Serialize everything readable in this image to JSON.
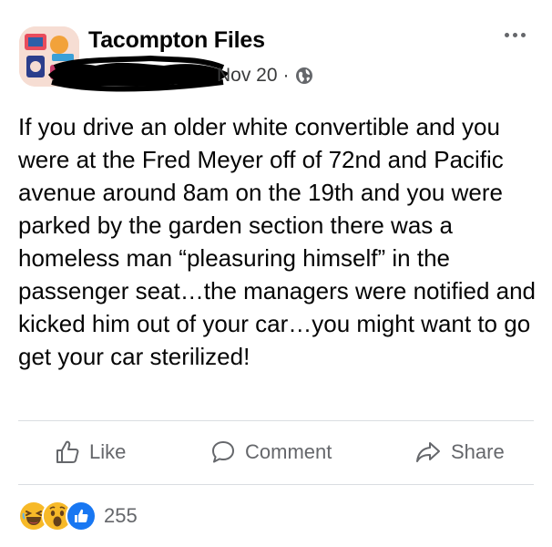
{
  "post": {
    "page_name": "Tacompton Files",
    "timestamp": "Nov 20",
    "separator": "·",
    "privacy_icon": "globe-icon",
    "body": "If you drive an older white convertible and you were at the Fred Meyer off of 72nd and Pacific avenue around 8am on the 19th and you were parked by the garden section there was a homeless man “pleasuring himself” in the passenger seat…the managers were notified and kicked him out of your car…you might want to go get your car sterilized!"
  },
  "actions": {
    "like_label": "Like",
    "comment_label": "Comment",
    "share_label": "Share"
  },
  "reactions": {
    "icons": [
      "haha-icon",
      "wow-icon",
      "like-icon"
    ],
    "count": "255"
  },
  "colors": {
    "text": "#050505",
    "secondary": "#65676b",
    "divider": "#dadde1",
    "like_blue": "#1877f2",
    "emoji_yellow": "#f7b928"
  }
}
